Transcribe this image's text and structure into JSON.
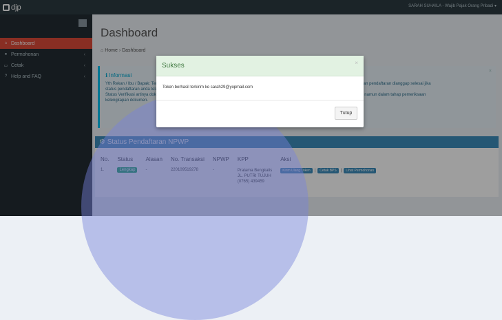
{
  "app": {
    "logo_text": "djp",
    "user_label": "SARAH SUHAILA - Wajib Pajak Orang Pribadi ▾"
  },
  "sidebar": {
    "items": [
      {
        "label": "Dashboard",
        "icon": "dashboard-icon",
        "active": true
      },
      {
        "label": "Permohonan",
        "icon": "user-icon",
        "active": false
      },
      {
        "label": "Cetak",
        "icon": "print-icon",
        "active": false
      },
      {
        "label": "Help and FAQ",
        "icon": "help-icon",
        "active": false
      }
    ]
  },
  "main": {
    "title": "Dashboard",
    "breadcrumb": {
      "home": "Home",
      "current": "Dashboard"
    },
    "info": {
      "title": "Informasi",
      "line1": "Yth Rekan / Ibu / Bapak: Terima kasih telah melakukan pendaftaran. Status pendaftaran anda dapat dilihat pada tabel dibawah ini. Permohonan pendaftaran dianggap selesai jika",
      "line2": "status pendaftaran anda telah Lengkap dan dokumen telah diverifikasi oleh petugas.",
      "line3": "Status Verifikasi artinya dokumen yang anda upload telah diperiksa. Status Lengkap artinya dokumen sudah lengkap dan pembayaran pajak, namun dalam tahap pemeriksaan",
      "line4": "kelengkapan dokumen."
    },
    "status": {
      "header": "Status Pendaftaran NPWP",
      "columns": [
        "No.",
        "Status",
        "Alasan",
        "No. Transaksi",
        "NPWP",
        "KPP",
        "Aksi"
      ],
      "row": {
        "no": "1.",
        "status": "Lengkap",
        "alasan": "-",
        "transaksi": "220109519278",
        "npwp": "-",
        "kpp1": "Pratama Bengkalis",
        "kpp2": "JL. PUTRI TUJUH",
        "kpp3": "(0765) 439459",
        "aksi1": "Kirim Ulang Token",
        "aksi2": "Cetak BPS",
        "aksi3": "Lihat Permohonan"
      }
    }
  },
  "modal": {
    "title": "Sukses",
    "close": "×",
    "message": "Token berhasil terkirim ke sarah29@yopmail.com",
    "button": "Tutup"
  },
  "colors": {
    "topbar": "#2c3b41",
    "sidebar": "#222d32",
    "active": "#dd4b39",
    "primary": "#3c8dbc",
    "success_bg": "#e2f2e2"
  }
}
